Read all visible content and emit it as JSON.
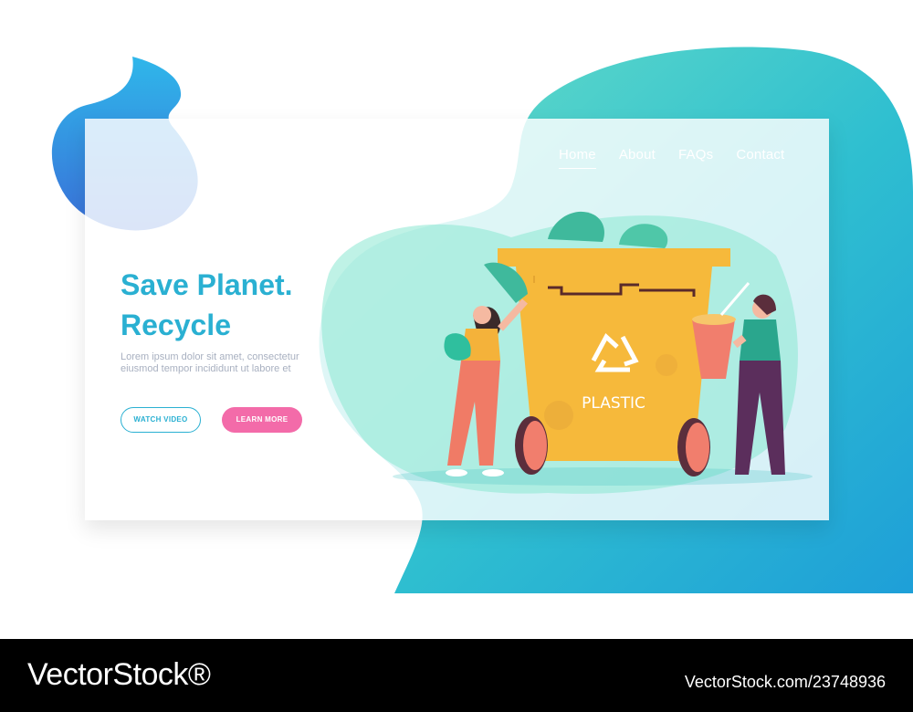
{
  "nav": {
    "items": [
      {
        "label": "Home",
        "active": true
      },
      {
        "label": "About",
        "active": false
      },
      {
        "label": "FAQs",
        "active": false
      },
      {
        "label": "Contact",
        "active": false
      }
    ]
  },
  "hero": {
    "title_line1": "Save Planet.",
    "title_line2": "Recycle",
    "body": "Lorem ipsum dolor sit amet, consectetur eiusmod tempor incididunt ut labore et",
    "watch_label": "WATCH VIDEO",
    "learn_label": "LEARN MORE"
  },
  "illustration": {
    "bin_label": "PLASTIC"
  },
  "watermark": {
    "logo": "VectorStock®",
    "image_id": "VectorStock.com/23748936"
  },
  "colors": {
    "accent": "#2ab0d2",
    "pink": "#f36ba9",
    "bin": "#f6b93b",
    "blob_teal": "#6fd6c4"
  }
}
